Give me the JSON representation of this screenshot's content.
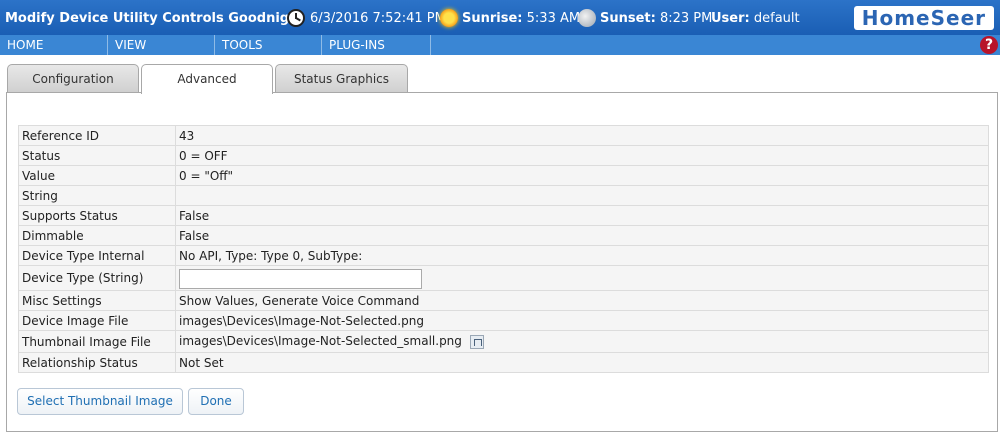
{
  "header": {
    "title": "Modify Device Utility Controls Goodnig...",
    "datetime": "6/3/2016 7:52:41 PM",
    "sunrise_label": "Sunrise:",
    "sunrise_value": "5:33 AM",
    "sunset_label": "Sunset:",
    "sunset_value": "8:23 PM",
    "user_label": "User:",
    "user_value": "default",
    "logo": "HomeSeer",
    "icons": [
      "clock-icon",
      "sun-icon",
      "moon-icon",
      "help-icon"
    ]
  },
  "nav": {
    "items": [
      "HOME",
      "VIEW",
      "TOOLS",
      "PLUG-INS"
    ],
    "help": "?"
  },
  "tabs": [
    {
      "label": "Configuration",
      "active": false
    },
    {
      "label": "Advanced",
      "active": true
    },
    {
      "label": "Status Graphics",
      "active": false
    }
  ],
  "properties": [
    {
      "label": "Reference ID",
      "value": "43"
    },
    {
      "label": "Status",
      "value": "0 = OFF"
    },
    {
      "label": "Value",
      "value": "0 = \"Off\""
    },
    {
      "label": "String",
      "value": ""
    },
    {
      "label": "Supports Status",
      "value": "False"
    },
    {
      "label": "Dimmable",
      "value": "False"
    },
    {
      "label": "Device Type Internal",
      "value": "No API, Type: Type 0, SubType:"
    },
    {
      "label": "Device Type (String)",
      "value": ""
    },
    {
      "label": "Misc Settings",
      "value": "Show Values, Generate Voice Command"
    },
    {
      "label": "Device Image File",
      "value": "images\\Devices\\Image-Not-Selected.png"
    },
    {
      "label": "Thumbnail Image File",
      "value": "images\\Devices\\Image-Not-Selected_small.png"
    },
    {
      "label": "Relationship Status",
      "value": "Not Set"
    }
  ],
  "buttons": {
    "select_thumbnail": "Select Thumbnail Image",
    "done": "Done"
  },
  "colors": {
    "header_bg": "#1a5eb4",
    "nav_bg": "#3a86d4",
    "button_text": "#1f6fb3"
  }
}
